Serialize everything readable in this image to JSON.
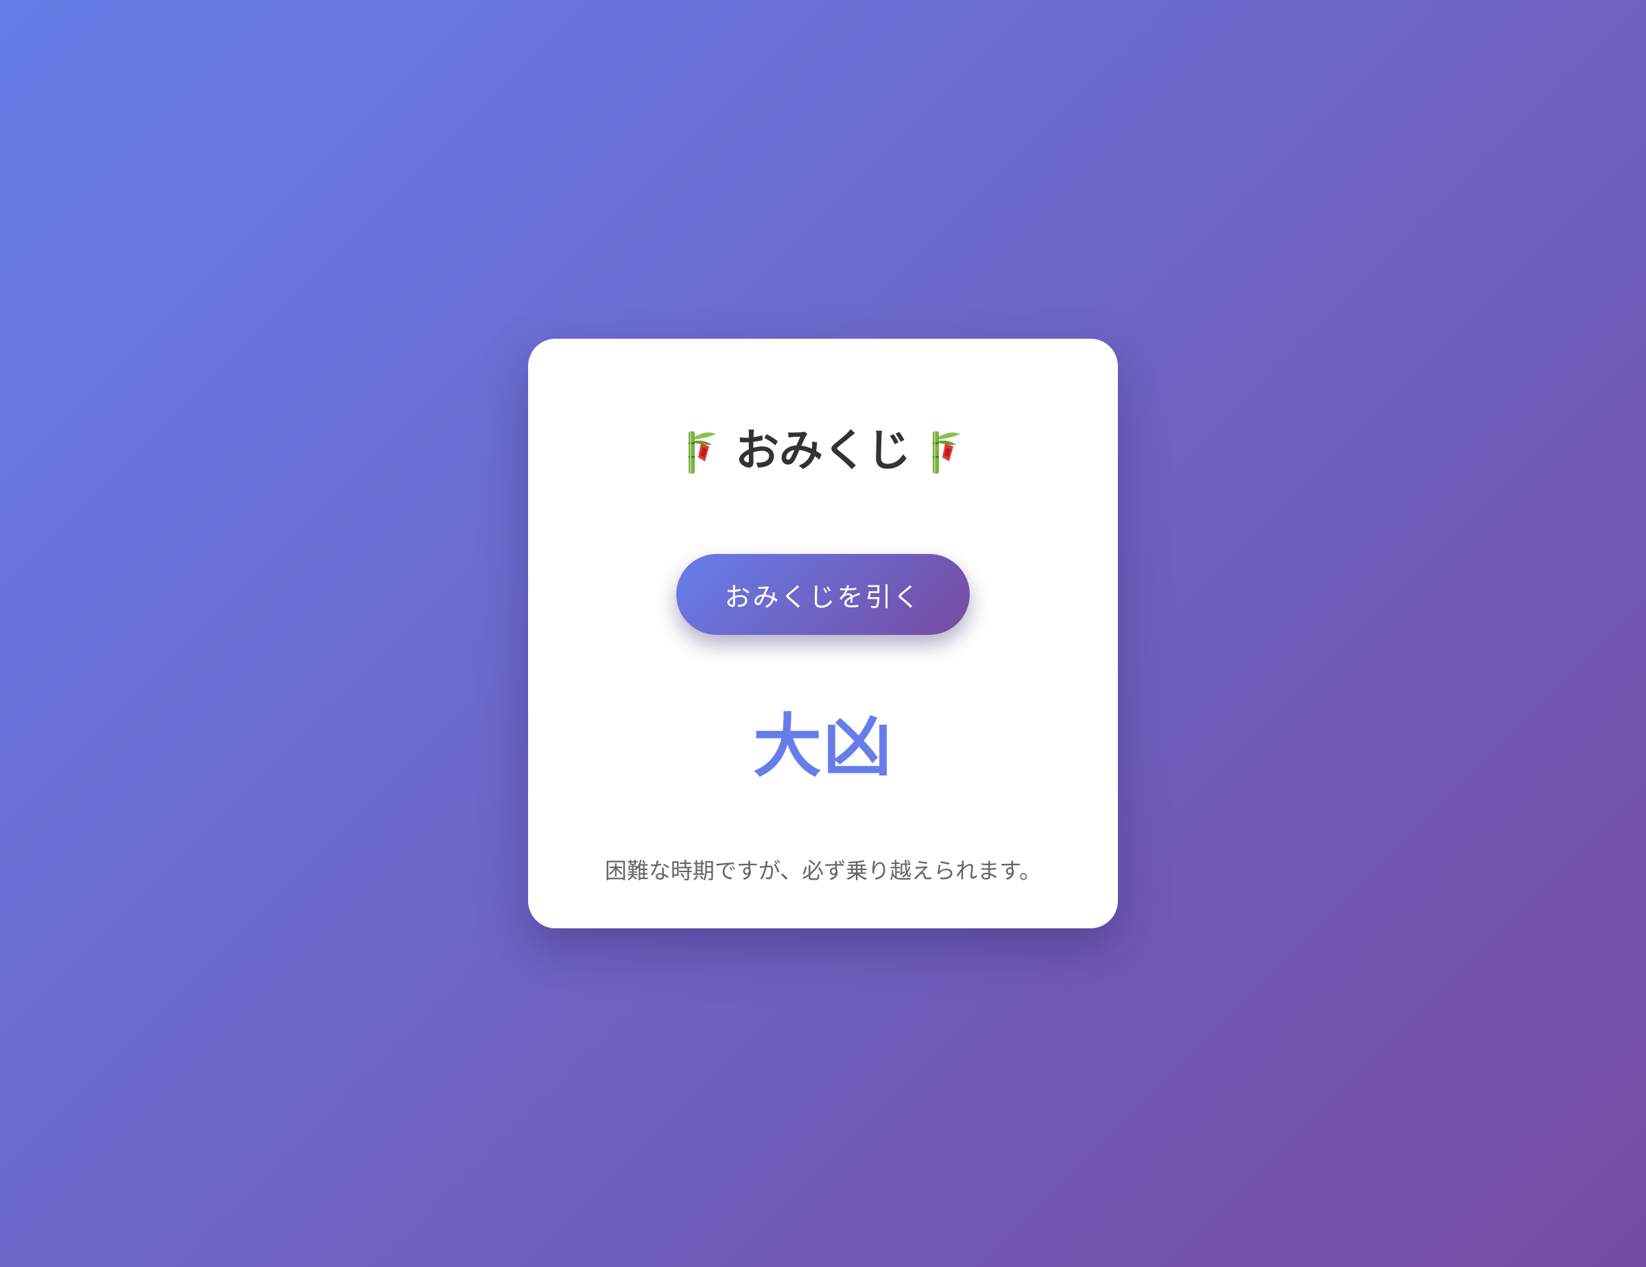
{
  "page": {
    "title": "おみくじ",
    "title_icon": "tanabata-bamboo-icon"
  },
  "draw_button": {
    "label": "おみくじを引く"
  },
  "fortune": {
    "result": "大凶",
    "message": "困難な時期ですが、必ず乗り越えられます。"
  },
  "colors": {
    "background_start": "#667eea",
    "background_end": "#764ba2",
    "accent": "#667eea",
    "title_text": "#333333",
    "message_text": "#666666"
  }
}
